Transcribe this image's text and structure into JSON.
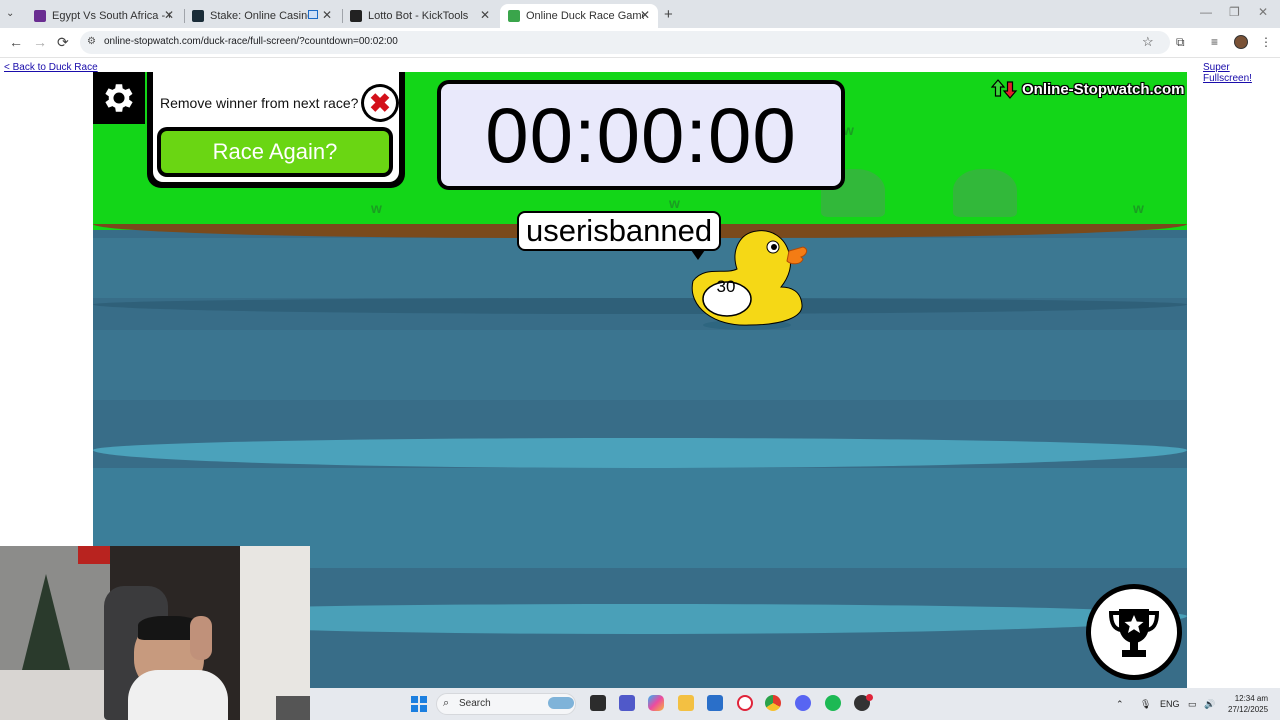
{
  "browser": {
    "tabs": [
      {
        "label": "Egypt Vs South Africa - Group S",
        "close": "✕",
        "fav_color": "#6a2d91"
      },
      {
        "label": "Stake: Online Casino & Spo",
        "close": "✕",
        "fav_color": "#1a2c38"
      },
      {
        "label": "Lotto Bot - KickTools",
        "close": "✕",
        "fav_color": "#222222"
      },
      {
        "label": "Online Duck Race Game",
        "close": "✕",
        "fav_color": "#3aa54b"
      }
    ],
    "new_tab": "+",
    "window_controls": {
      "minimize": "—",
      "restore": "❐",
      "close": "✕"
    },
    "nav": {
      "back": "←",
      "forward": "→",
      "reload": "⟳"
    },
    "address": "online-stopwatch.com/duck-race/full-screen/?countdown=00:02:00",
    "icons": [
      "site-info-icon",
      "star-icon",
      "extensions-icon",
      "media-icon",
      "profile-avatar",
      "menu-icon"
    ]
  },
  "page": {
    "back_link": "< Back to Duck Race",
    "fullscreen_link": "Super Fullscreen!"
  },
  "game": {
    "remove_label": "Remove winner from next race?",
    "remove_x": "✖",
    "race_again": "Race Again?",
    "timer": "00:00:00",
    "brand": "Online-Stopwatch.com",
    "winner_name": "userisbanned",
    "duck_number": "30",
    "colors": {
      "grass": "#13d618",
      "water": "#386d88",
      "race_button": "#6ad613",
      "timer_bg": "#e9e9fb",
      "duck": "#f5d816"
    }
  },
  "taskbar": {
    "search": "Search",
    "apps": [
      "windows-start-icon",
      "widgets-icon",
      "file-explorer-icon",
      "teams-icon",
      "copilot-icon",
      "folder-icon",
      "store-icon",
      "opera-icon",
      "chrome-icon",
      "discord-icon",
      "spotify-icon",
      "app-icon"
    ],
    "tray": {
      "language": "ENG",
      "time": "12:34 am",
      "date": "27/12/2025"
    }
  }
}
